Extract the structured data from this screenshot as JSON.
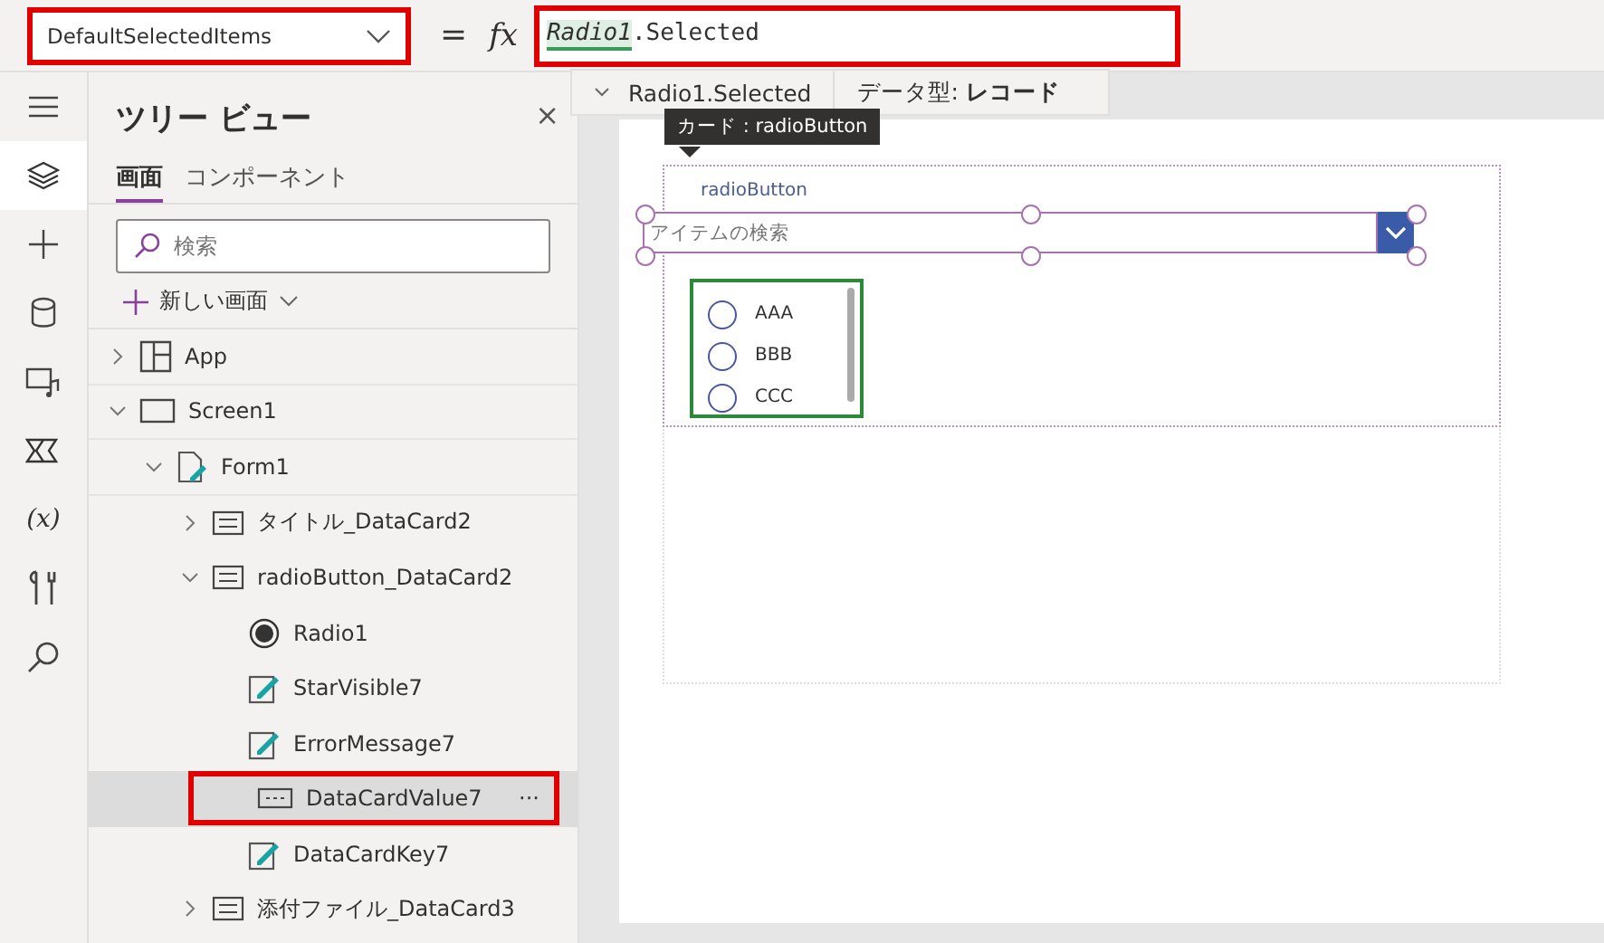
{
  "formula_bar": {
    "property": "DefaultSelectedItems",
    "property_annotated": true,
    "equals": "=",
    "fx": "fx",
    "formula_ref": "Radio1",
    "formula_rest": ".Selected",
    "formula_annotated": true
  },
  "autocomplete": {
    "expression": "Radio1.Selected",
    "type_label": "データ型: ",
    "type_value": "レコード"
  },
  "rail": [
    {
      "kind": "menu",
      "selected": false
    },
    {
      "kind": "layers",
      "selected": true
    },
    {
      "kind": "plus",
      "selected": false
    },
    {
      "kind": "data",
      "selected": false
    },
    {
      "kind": "media",
      "selected": false
    },
    {
      "kind": "flow",
      "selected": false
    },
    {
      "kind": "variables",
      "glyph": "(x)",
      "selected": false
    },
    {
      "kind": "tools",
      "selected": false
    },
    {
      "kind": "search",
      "selected": false
    }
  ],
  "tree_panel": {
    "title": "ツリー ビュー",
    "close": "×",
    "tabs": [
      {
        "label": "画面",
        "selected": true
      },
      {
        "label": "コンポーネント",
        "selected": false
      }
    ],
    "search": {
      "placeholder": "検索"
    },
    "new_screen": "新しい画面",
    "items": [
      {
        "label": "App",
        "kind": "app",
        "expanded": false,
        "selected": false,
        "annotated": false
      },
      {
        "label": "Screen1",
        "kind": "screen",
        "expanded": true,
        "selected": false,
        "annotated": false,
        "children": [
          {
            "label": "Form1",
            "kind": "form",
            "expanded": true,
            "selected": false,
            "annotated": false,
            "children": [
              {
                "label": "タイトル_DataCard2",
                "kind": "card",
                "expanded": false,
                "selected": false,
                "annotated": false
              },
              {
                "label": "radioButton_DataCard2",
                "kind": "card",
                "expanded": true,
                "selected": false,
                "annotated": false,
                "children": [
                  {
                    "label": "Radio1",
                    "kind": "radio",
                    "selected": false,
                    "annotated": false
                  },
                  {
                    "label": "StarVisible7",
                    "kind": "edit",
                    "selected": false,
                    "annotated": false
                  },
                  {
                    "label": "ErrorMessage7",
                    "kind": "edit",
                    "selected": false,
                    "annotated": false
                  },
                  {
                    "label": "DataCardValue7",
                    "kind": "input",
                    "selected": true,
                    "annotated": true,
                    "more": "···"
                  },
                  {
                    "label": "DataCardKey7",
                    "kind": "edit",
                    "selected": false,
                    "annotated": false
                  }
                ]
              },
              {
                "label": "添付ファイル_DataCard3",
                "kind": "card",
                "expanded": false,
                "selected": false,
                "annotated": false
              }
            ]
          }
        ]
      }
    ]
  },
  "canvas": {
    "tooltip": "カード : radioButton",
    "card_label": "radioButton",
    "combo_placeholder": "アイテムの検索",
    "radio_options": [
      {
        "label": "AAA",
        "selected": false
      },
      {
        "label": "BBB",
        "selected": false
      },
      {
        "label": "CCC",
        "selected": false
      }
    ]
  }
}
